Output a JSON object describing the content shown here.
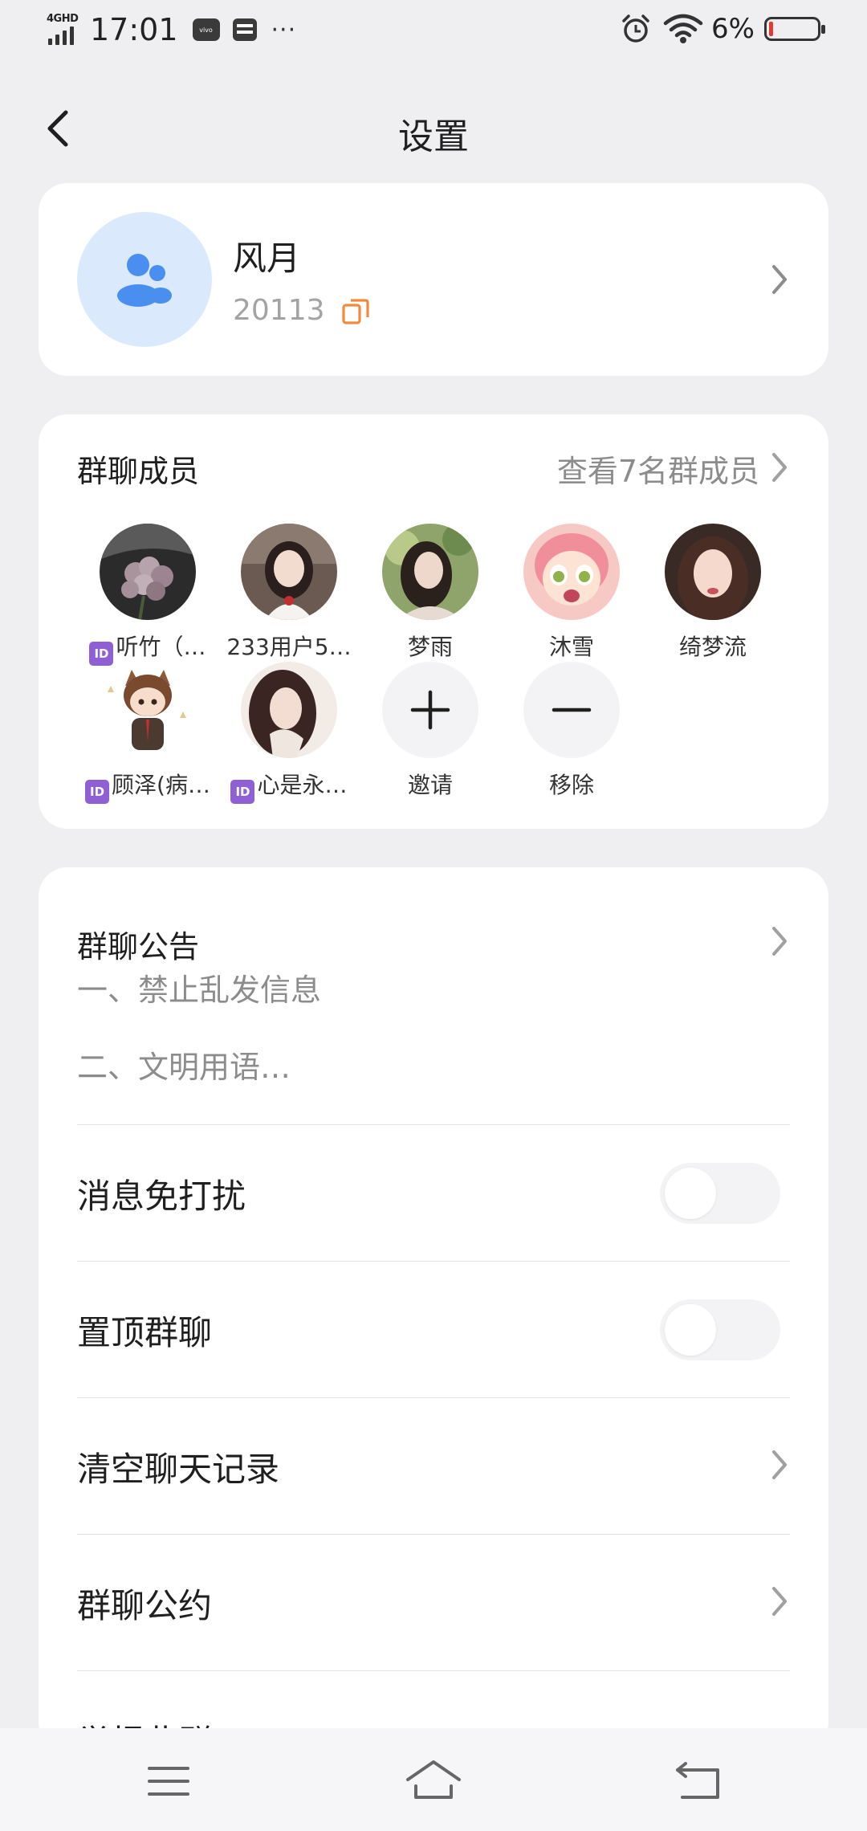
{
  "status_bar": {
    "network": "4GHD",
    "time": "17:01",
    "carrier_icon_text": "vivo",
    "dots": "···",
    "battery_percent": "6%",
    "battery_level": 0.06
  },
  "header": {
    "title": "设置"
  },
  "group": {
    "name": "风月",
    "id": "20113"
  },
  "members": {
    "section_title": "群聊成员",
    "view_all": "查看7名群成员",
    "id_badge": "ID",
    "list": [
      {
        "name": "听竹（…",
        "badge": true
      },
      {
        "name": "233用户5…",
        "badge": false
      },
      {
        "name": "梦雨",
        "badge": false
      },
      {
        "name": "沐雪",
        "badge": false
      },
      {
        "name": "绮梦流",
        "badge": false
      },
      {
        "name": "顾泽(病…",
        "badge": true
      },
      {
        "name": "心是永…",
        "badge": true
      }
    ],
    "invite_label": "邀请",
    "remove_label": "移除"
  },
  "settings": {
    "notice_title": "群聊公告",
    "notice_line1": "一、禁止乱发信息",
    "notice_line2": "二、文明用语…",
    "mute_label": "消息免打扰",
    "mute_on": false,
    "pin_label": "置顶群聊",
    "pin_on": false,
    "clear_label": "清空聊天记录",
    "rules_label": "群聊公约",
    "report_label": "举报此群"
  },
  "colors": {
    "accent_blue": "#4a8ff0",
    "copy_orange": "#f08a3c",
    "id_badge_purple": "#8f5fd6"
  }
}
